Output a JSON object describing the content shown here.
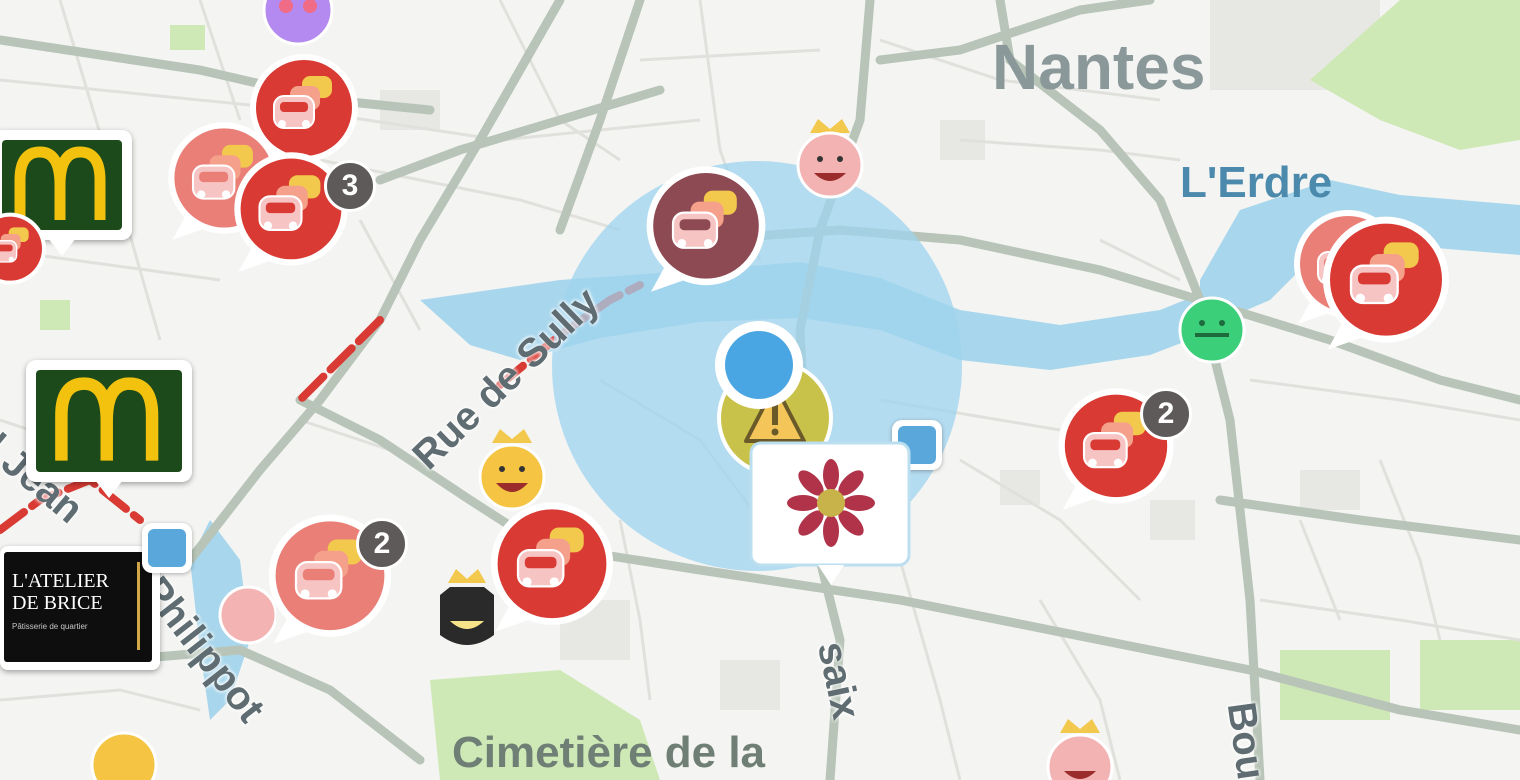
{
  "map": {
    "city_label": "Nantes",
    "water_label": "L'Erdre",
    "street_labels": {
      "rue_de_sully": "Rue de Sully",
      "desaix": "saix",
      "jean": "l Jean",
      "philippot": "Philippot",
      "bou": "Bou"
    },
    "cemetery_label": "Cimetière de la",
    "poi_atelier": {
      "line1": "L'ATELIER",
      "line2": "DE BRICE",
      "tagline": "Pâtisserie de quartier"
    },
    "badge_counts": {
      "cluster_left": "3",
      "cluster_right": "2",
      "cluster_bottom_left": "2"
    },
    "colors": {
      "background": "#f4f4f2",
      "water": "#a8d6ec",
      "park": "#cfe9b6",
      "major_road": "#b7c4b7",
      "traffic_jam": "#d93a33",
      "traffic_jam_light": "#ea7f78",
      "user_location": "#4aa6e2",
      "accuracy_circle": "#9fd4ef",
      "mcdonalds_green": "#1c4a1a",
      "mcdonalds_yellow": "#f2c20e",
      "badge_gray": "#5e5a5a"
    },
    "icons": [
      "traffic-jam-icon",
      "mcdonalds-logo-icon",
      "parking-icon",
      "user-location-icon",
      "hazard-warning-icon",
      "flower-poi-icon",
      "wazer-avatar-icon"
    ]
  }
}
